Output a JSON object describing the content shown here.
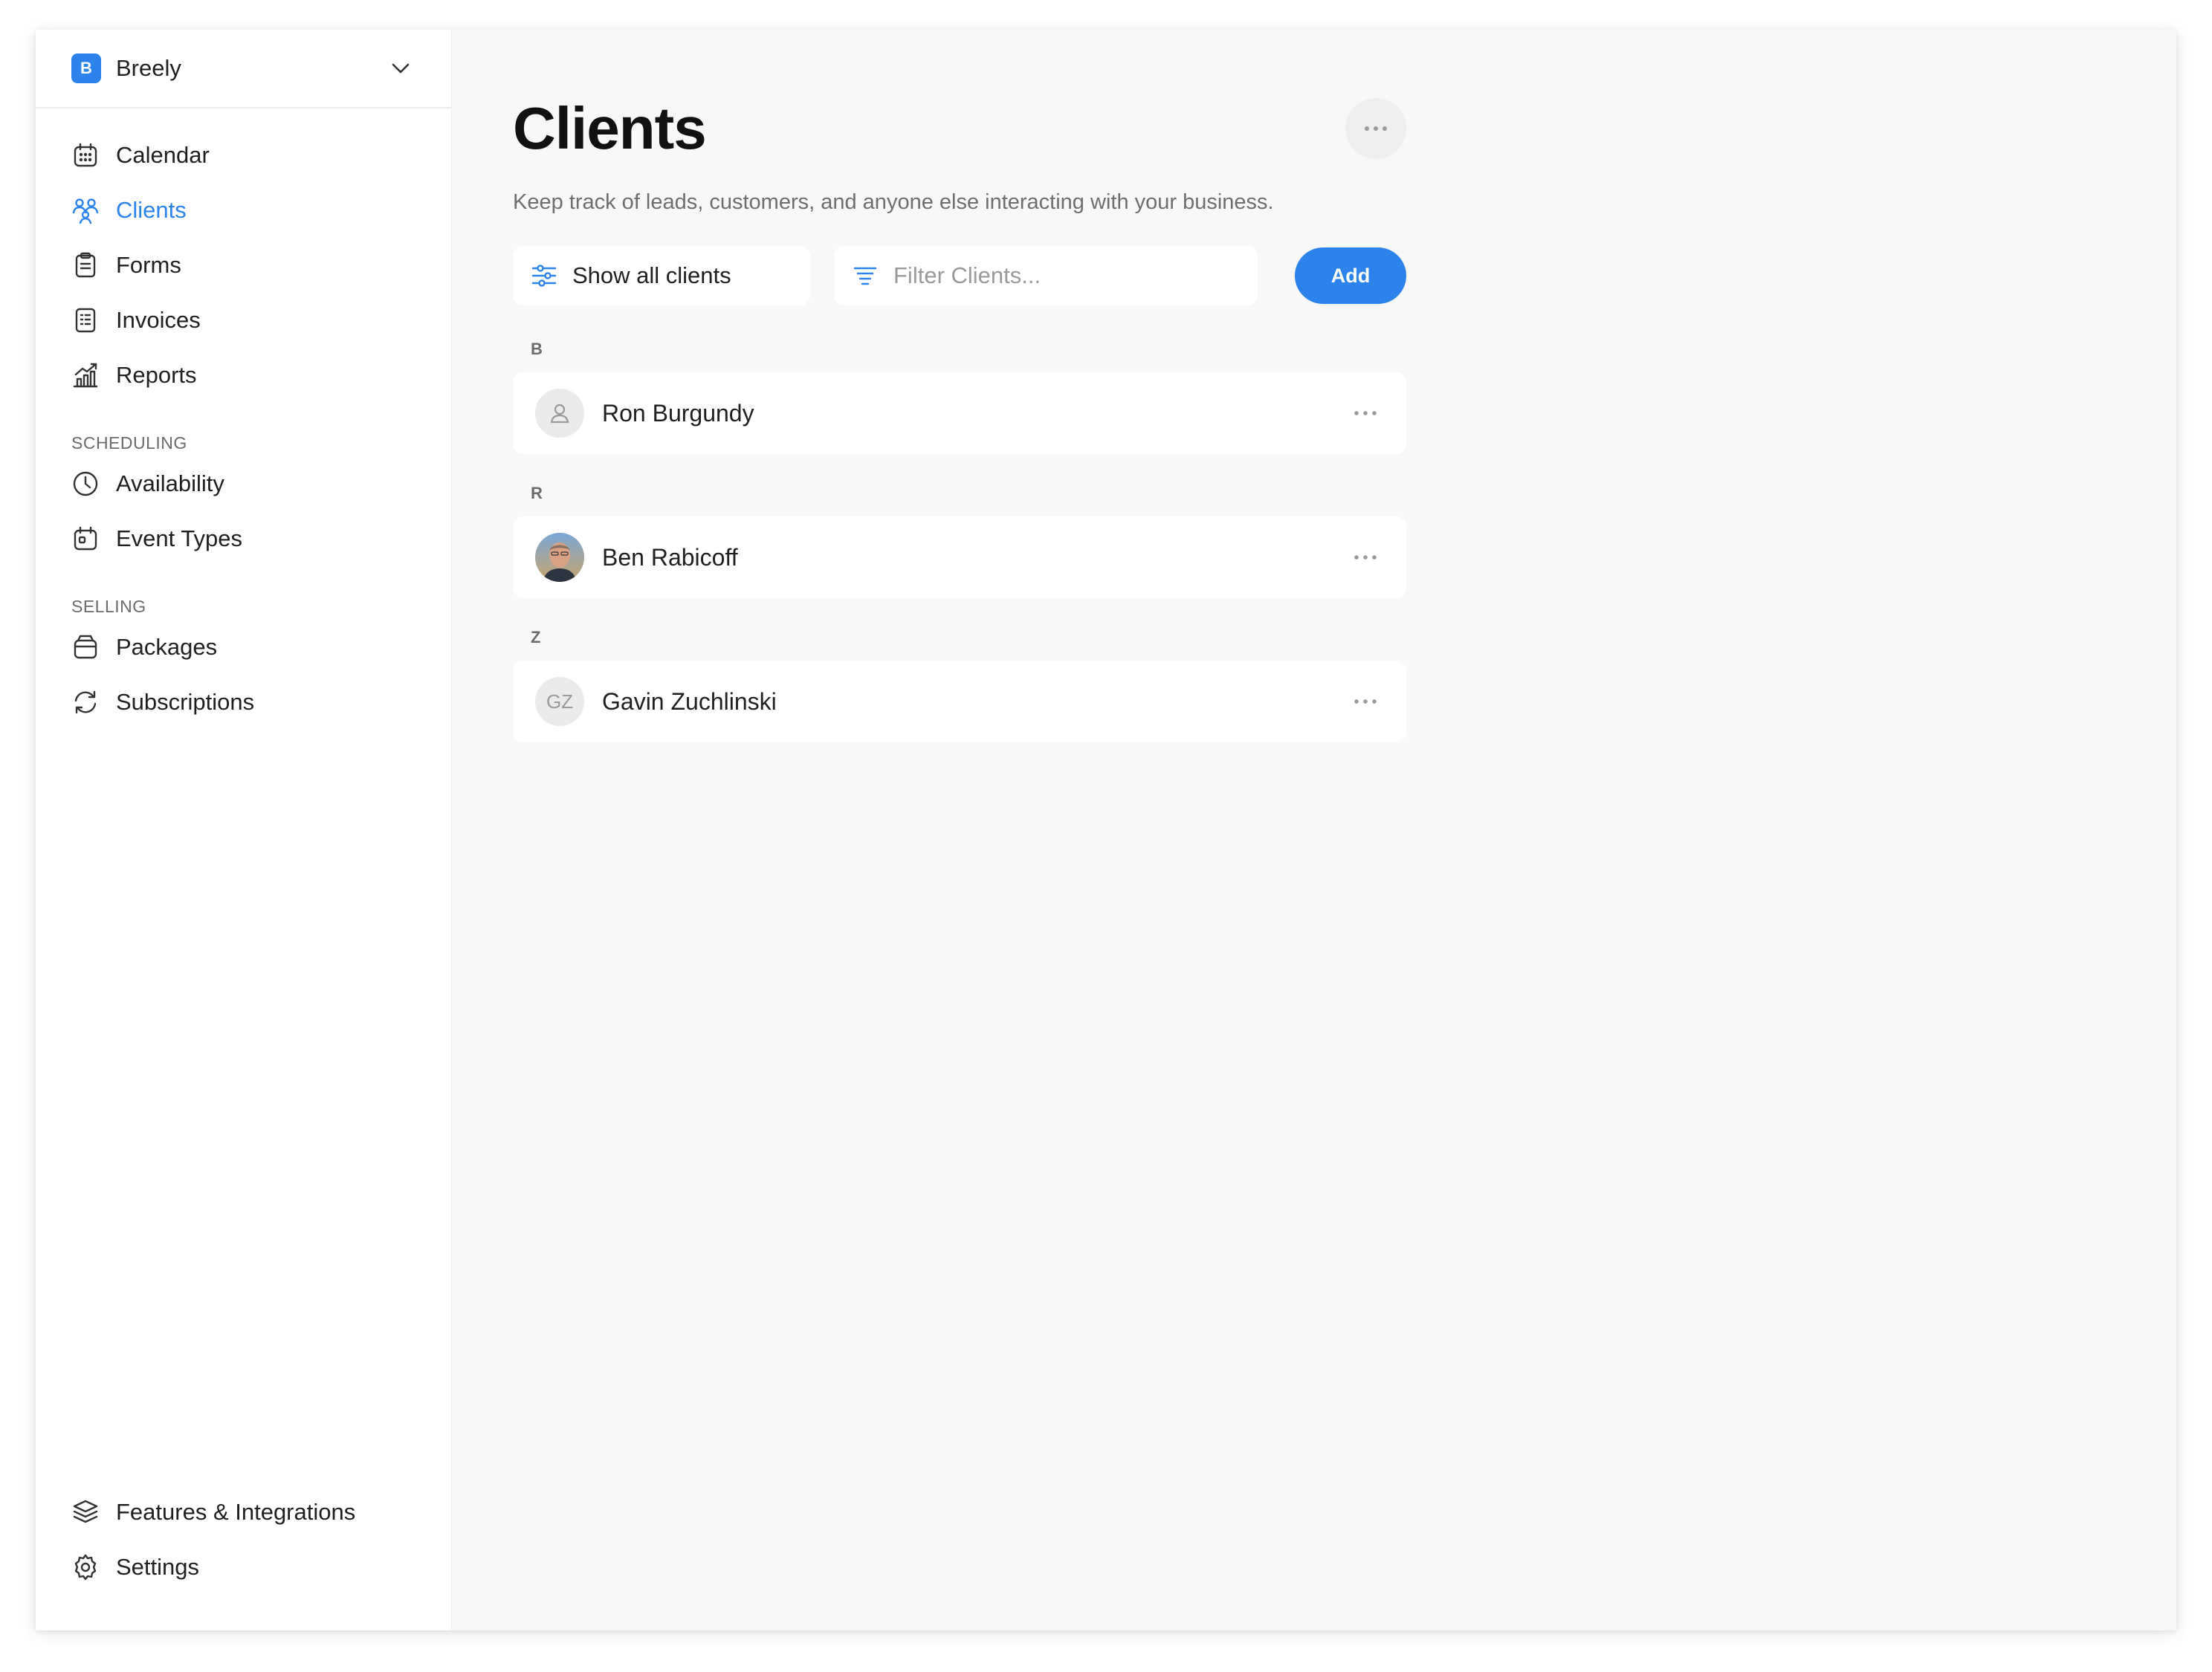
{
  "workspace": {
    "badge": "B",
    "name": "Breely"
  },
  "nav": {
    "items": [
      {
        "label": "Calendar",
        "icon": "calendar-icon"
      },
      {
        "label": "Clients",
        "icon": "users-icon",
        "active": true
      },
      {
        "label": "Forms",
        "icon": "clipboard-icon"
      },
      {
        "label": "Invoices",
        "icon": "receipt-icon"
      },
      {
        "label": "Reports",
        "icon": "chart-icon"
      }
    ],
    "scheduling_label": "SCHEDULING",
    "scheduling": [
      {
        "label": "Availability",
        "icon": "clock-icon"
      },
      {
        "label": "Event Types",
        "icon": "event-icon"
      }
    ],
    "selling_label": "SELLING",
    "selling": [
      {
        "label": "Packages",
        "icon": "package-icon"
      },
      {
        "label": "Subscriptions",
        "icon": "refresh-icon"
      }
    ],
    "bottom": [
      {
        "label": "Features & Integrations",
        "icon": "layers-icon"
      },
      {
        "label": "Settings",
        "icon": "gear-icon"
      }
    ]
  },
  "page": {
    "title": "Clients",
    "subtitle": "Keep track of leads, customers, and anyone else interacting with your business."
  },
  "toolbar": {
    "show_all_label": "Show all clients",
    "filter_placeholder": "Filter Clients...",
    "filter_value": "",
    "add_label": "Add"
  },
  "groups": [
    {
      "letter": "B",
      "clients": [
        {
          "name": "Ron Burgundy",
          "avatar": "person-placeholder"
        }
      ]
    },
    {
      "letter": "R",
      "clients": [
        {
          "name": "Ben Rabicoff",
          "avatar": "photo"
        }
      ]
    },
    {
      "letter": "Z",
      "clients": [
        {
          "name": "Gavin Zuchlinski",
          "avatar": "initials",
          "initials": "GZ"
        }
      ]
    }
  ],
  "colors": {
    "accent": "#2d83ec",
    "background": "#f8f8f8",
    "sidebar": "#ffffff"
  }
}
